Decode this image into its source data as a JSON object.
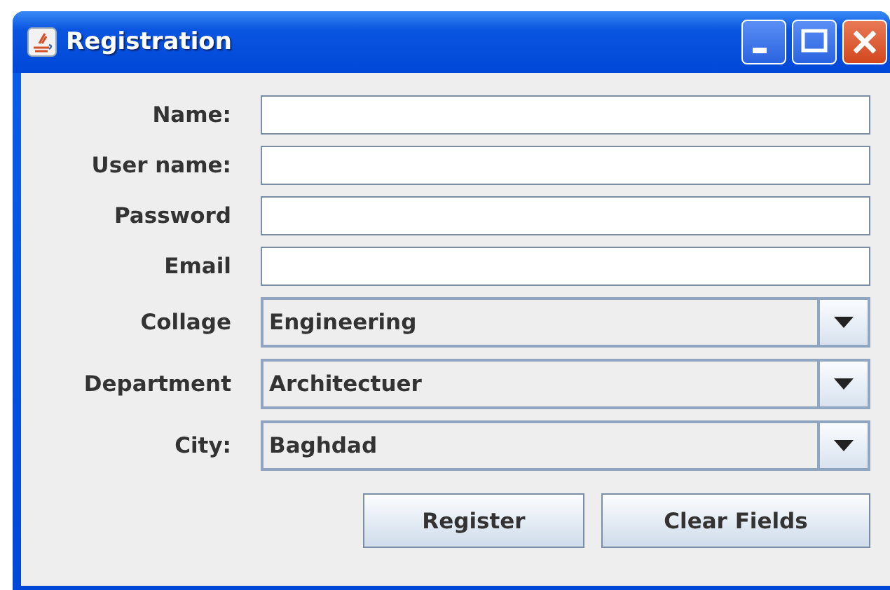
{
  "window": {
    "title": "Registration"
  },
  "fields": [
    {
      "label": "Name:",
      "kind": "text"
    },
    {
      "label": "User name:",
      "kind": "text"
    },
    {
      "label": "Password",
      "kind": "text"
    },
    {
      "label": "Email",
      "kind": "text"
    },
    {
      "label": "Collage",
      "kind": "combo",
      "value": "Engineering"
    },
    {
      "label": "Department",
      "kind": "combo",
      "value": "Architectuer"
    },
    {
      "label": "City:",
      "kind": "combo",
      "value": "Baghdad"
    }
  ],
  "buttons": [
    "Register",
    "Clear Fields"
  ]
}
